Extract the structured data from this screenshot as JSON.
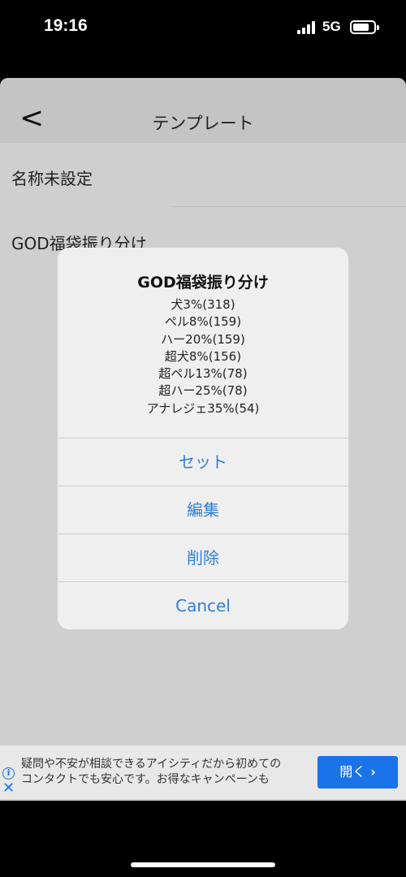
{
  "status": {
    "time": "19:16",
    "network": "5G"
  },
  "nav": {
    "back_label": "<",
    "title": "テンプレート"
  },
  "list": {
    "items": [
      {
        "label": "名称未設定"
      },
      {
        "label": "GOD福袋振り分け"
      }
    ]
  },
  "alert": {
    "title": "GOD福袋振り分け",
    "lines": [
      "犬3%(318)",
      "ペル8%(159)",
      "ハー20%(159)",
      "超犬8%(156)",
      "超ペル13%(78)",
      "超ハー25%(78)",
      "アナレジェ35%(54)"
    ],
    "actions": [
      {
        "label": "セット"
      },
      {
        "label": "編集"
      },
      {
        "label": "削除"
      },
      {
        "label": "Cancel"
      }
    ],
    "action_color": "#2f7fd8"
  },
  "ad": {
    "text_line1": "疑問や不安が相談できるアイシティだから初めての",
    "text_line2": "コンタクトでも安心です。お得なキャンペーンも",
    "button_label": "開く",
    "button_chevron": "›",
    "info_icon": "i",
    "close_icon": "✕",
    "accent_color": "#1a73e8"
  }
}
